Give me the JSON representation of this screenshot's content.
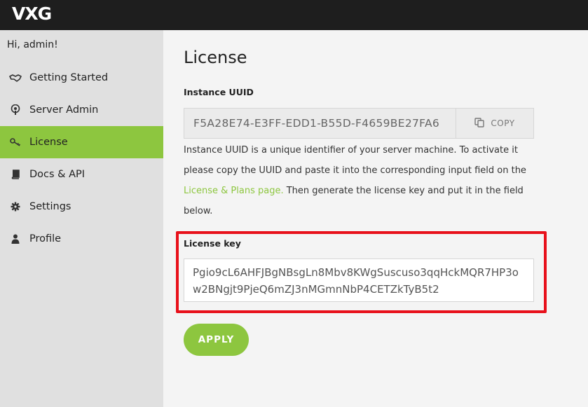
{
  "app": {
    "logo_text": "VXG"
  },
  "sidebar": {
    "greeting": "Hi, admin!",
    "items": [
      {
        "label": "Getting Started",
        "icon": "handshake-icon",
        "active": false
      },
      {
        "label": "Server Admin",
        "icon": "podcast-icon",
        "active": false
      },
      {
        "label": "License",
        "icon": "key-icon",
        "active": true
      },
      {
        "label": "Docs & API",
        "icon": "book-icon",
        "active": false
      },
      {
        "label": "Settings",
        "icon": "gear-icon",
        "active": false
      },
      {
        "label": "Profile",
        "icon": "user-icon",
        "active": false
      }
    ]
  },
  "main": {
    "title": "License",
    "uuid_label": "Instance UUID",
    "uuid_value": "F5A28E74-E3FF-EDD1-B55D-F4659BE27FA6",
    "copy_label": "COPY",
    "description_before": "Instance UUID is a unique identifier of your server machine. To activate it please copy the UUID and paste it into the corresponding input field on the ",
    "description_link": "License & Plans page.",
    "description_after": " Then generate the license key and put it in the field below.",
    "license_key_label": "License key",
    "license_key_value": "Pgio9cL6AHFJBgNBsgLn8Mbv8KWgSuscuso3qqHckMQR7HP3ow2BNgjt9PjeQ6mZJ3nMGmnNbP4CETZkTyB5t2",
    "apply_label": "APPLY"
  },
  "colors": {
    "accent": "#8dc63f",
    "topbar": "#1e1e1e",
    "highlight": "#e8111b"
  }
}
